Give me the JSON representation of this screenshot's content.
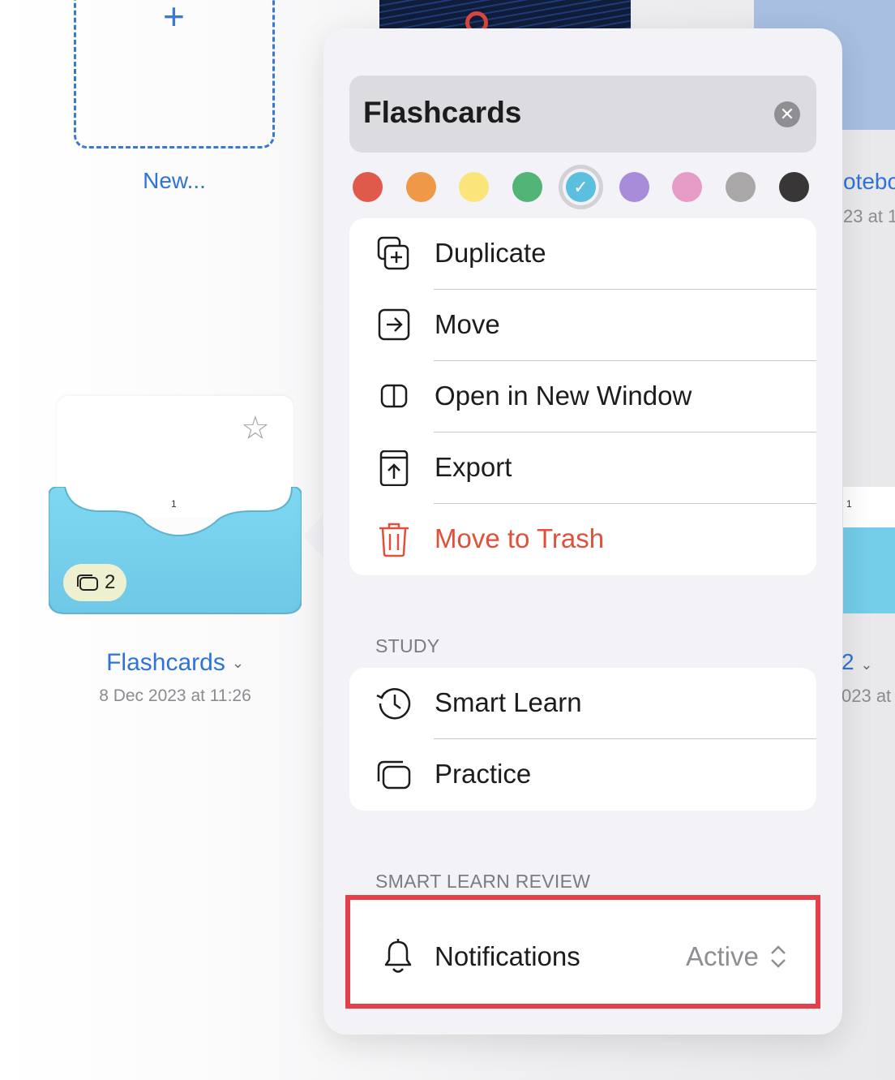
{
  "background": {
    "new_tile": {
      "label": "New..."
    },
    "right_item": {
      "title_fragment": "otebo",
      "date_fragment": "23 at 1",
      "page_number": "1"
    },
    "right_item2": {
      "title_fragment": "2",
      "date_fragment": "023 at 1"
    },
    "flashcards_folder": {
      "page_number": "1",
      "card_count": "2",
      "title": "Flashcards",
      "date": "8 Dec 2023 at 11:26"
    }
  },
  "popover": {
    "name_field": {
      "value": "Flashcards"
    },
    "colors": [
      "#e05a4b",
      "#ee9848",
      "#fbe47a",
      "#52b476",
      "#5cbfe0",
      "#a88cd9",
      "#e69cc6",
      "#a9a7a7",
      "#383636"
    ],
    "selected_color_index": 4,
    "actions": [
      {
        "label": "Duplicate",
        "icon": "duplicate-icon"
      },
      {
        "label": "Move",
        "icon": "move-icon"
      },
      {
        "label": "Open in New Window",
        "icon": "split-window-icon"
      },
      {
        "label": "Export",
        "icon": "export-icon"
      },
      {
        "label": "Move to Trash",
        "icon": "trash-icon"
      }
    ],
    "study": {
      "header": "STUDY",
      "items": [
        {
          "label": "Smart Learn",
          "icon": "history-clock-icon"
        },
        {
          "label": "Practice",
          "icon": "cards-icon"
        }
      ]
    },
    "smart_learn_review": {
      "header": "SMART LEARN REVIEW",
      "notifications": {
        "label": "Notifications",
        "value": "Active",
        "icon": "bell-icon"
      }
    }
  },
  "colors": {
    "accent": "#2f73d6",
    "danger": "#e0503a",
    "highlight": "#e5404a"
  }
}
